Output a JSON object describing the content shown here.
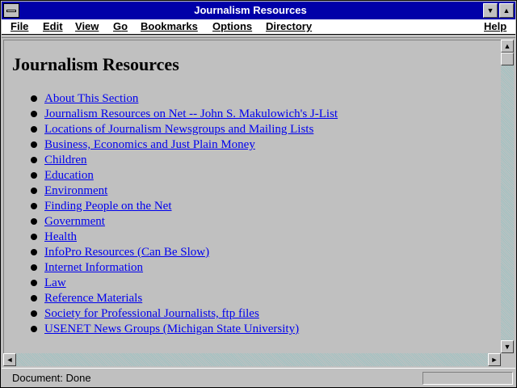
{
  "window": {
    "title": "Journalism Resources",
    "minimize_glyph": "▼",
    "maximize_glyph": "▲"
  },
  "menu": {
    "items": [
      "File",
      "Edit",
      "View",
      "Go",
      "Bookmarks",
      "Options",
      "Directory"
    ],
    "help": "Help"
  },
  "page": {
    "title": "Journalism Resources",
    "links": [
      "About This Section",
      "Journalism Resources on Net -- John S. Makulowich's J-List",
      "Locations of Journalism Newsgroups and Mailing Lists",
      "Business, Economics and Just Plain Money",
      "Children",
      "Education",
      "Environment",
      "Finding People on the Net",
      "Government",
      "Health",
      "InfoPro Resources (Can Be Slow)",
      "Internet Information",
      "Law",
      "Reference Materials",
      "Society for Professional Journalists, ftp files",
      "USENET News Groups (Michigan State University)"
    ]
  },
  "scroll": {
    "up": "▲",
    "down": "▼",
    "left": "◄",
    "right": "►"
  },
  "status": {
    "text": "Document: Done"
  },
  "colors": {
    "title_bar": "#0000a8",
    "link": "#0000ee",
    "background": "#c0c0c0"
  }
}
